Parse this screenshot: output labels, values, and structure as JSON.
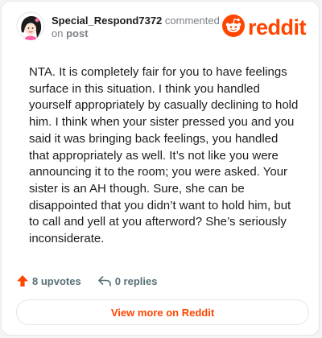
{
  "comment": {
    "username": "Special_Respond7372",
    "action_text": "commented",
    "on_text": "on",
    "post_link": "post",
    "body": "NTA. It is completely fair for you to have feelings surface in this situation. I think you handled yourself appropriately by casually declining to hold him. I think when your sister pressed you and you said it was bringing back feelings, you handled that appropriately as well. It’s not like you were announcing it to the room; you were asked. Your sister is an AH though. Sure, she can be disappointed that you didn’t want to hold him, but to call and yell at you afterword? She’s seriously inconsiderate."
  },
  "brand": {
    "name": "reddit",
    "color": "#ff4500"
  },
  "actions": {
    "upvotes_label": "8 upvotes",
    "replies_label": "0 replies"
  },
  "footer": {
    "view_more_label": "View more on Reddit"
  },
  "icons": {
    "avatar": "user-avatar",
    "logo": "reddit-snoo-icon",
    "upvote": "upvote-arrow-icon",
    "reply": "reply-arrow-icon"
  }
}
